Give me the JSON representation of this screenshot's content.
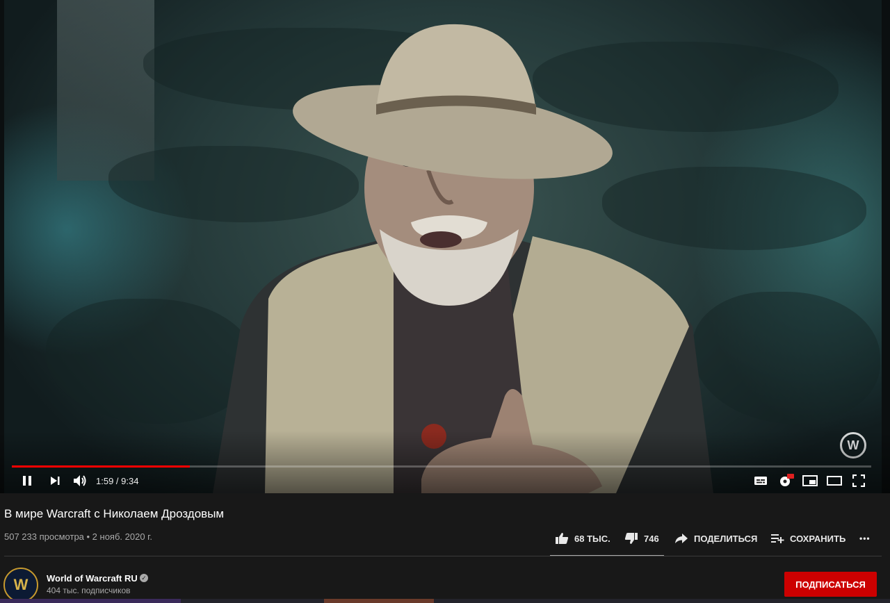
{
  "video": {
    "current_time": "1:59",
    "duration": "9:34",
    "time_display": "1:59 / 9:34",
    "progress_fraction": 0.2073,
    "watermark": "W"
  },
  "title": "В мире Warcraft с Николаем Дроздовым",
  "meta": "507 233 просмотра • 2 нояб. 2020 г.",
  "actions": {
    "likes": "68 ТЫС.",
    "dislikes": "746",
    "share": "ПОДЕЛИТЬСЯ",
    "save": "СОХРАНИТЬ",
    "more": "•••"
  },
  "channel": {
    "name": "World of Warcraft RU",
    "subscribers": "404 тыс. подписчиков",
    "avatar_letter": "W",
    "subscribe_label": "ПОДПИСАТЬСЯ"
  },
  "colors": {
    "accent": "#ff0000",
    "subscribe": "#cc0000",
    "background": "#181818"
  }
}
